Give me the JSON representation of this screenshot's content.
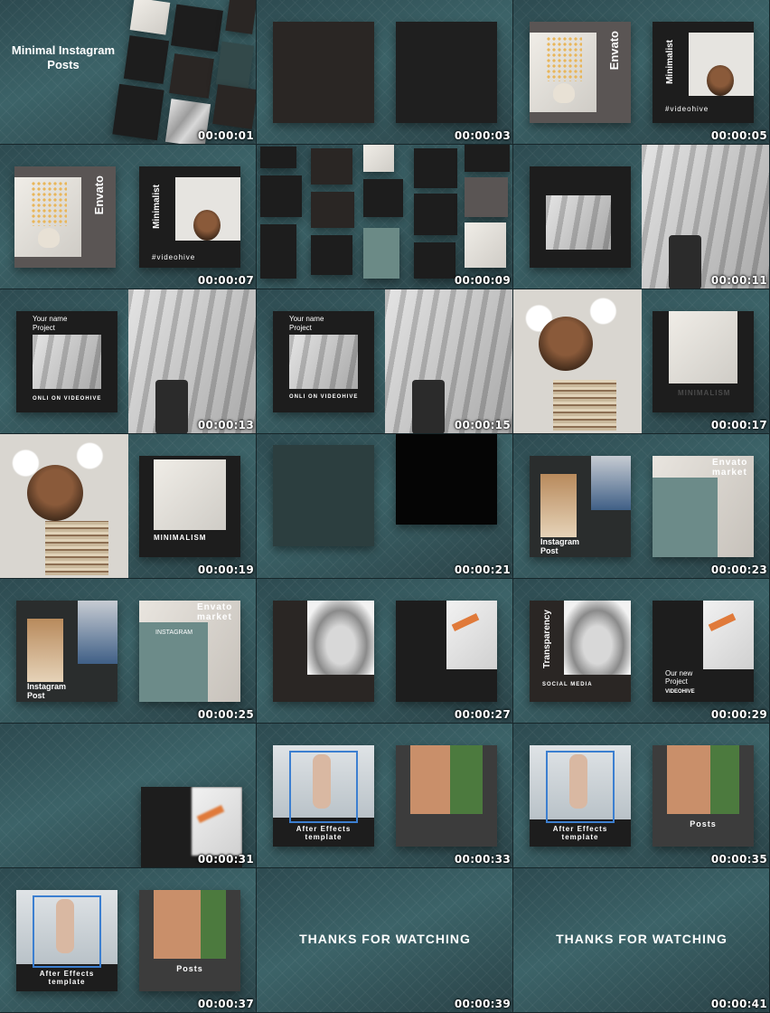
{
  "timestamps": [
    "00:00:01",
    "00:00:03",
    "00:00:05",
    "00:00:07",
    "00:00:09",
    "00:00:11",
    "00:00:13",
    "00:00:15",
    "00:00:17",
    "00:00:19",
    "00:00:21",
    "00:00:23",
    "00:00:25",
    "00:00:27",
    "00:00:29",
    "00:00:31",
    "00:00:33",
    "00:00:35",
    "00:00:37",
    "00:00:39",
    "00:00:41"
  ],
  "texts": {
    "title_line1": "Minimal Instagram",
    "title_line2": "Posts",
    "envato": "Envato",
    "minimalist": "Minimalist",
    "videohive_tag": "#videohive",
    "your_name": "Your name",
    "project": "Project",
    "onli_on_videohive": "ONLI ON VIDEOHIVE",
    "minimalism": "MINIMALISM",
    "instagram_post_1": "Instagram",
    "instagram_post_2": "Post",
    "envato_market_1": "Envato",
    "envato_market_2": "market",
    "instagram_caps": "INSTAGRAM",
    "transparency": "Transparency",
    "social_media": "SOCIAL MEDIA",
    "our_new": "Our new",
    "videohive_caps": "VIDEOHIVE",
    "after_effects_1": "After Effects",
    "after_effects_2": "template",
    "posts": "Posts",
    "thanks": "THANKS FOR WATCHING"
  }
}
